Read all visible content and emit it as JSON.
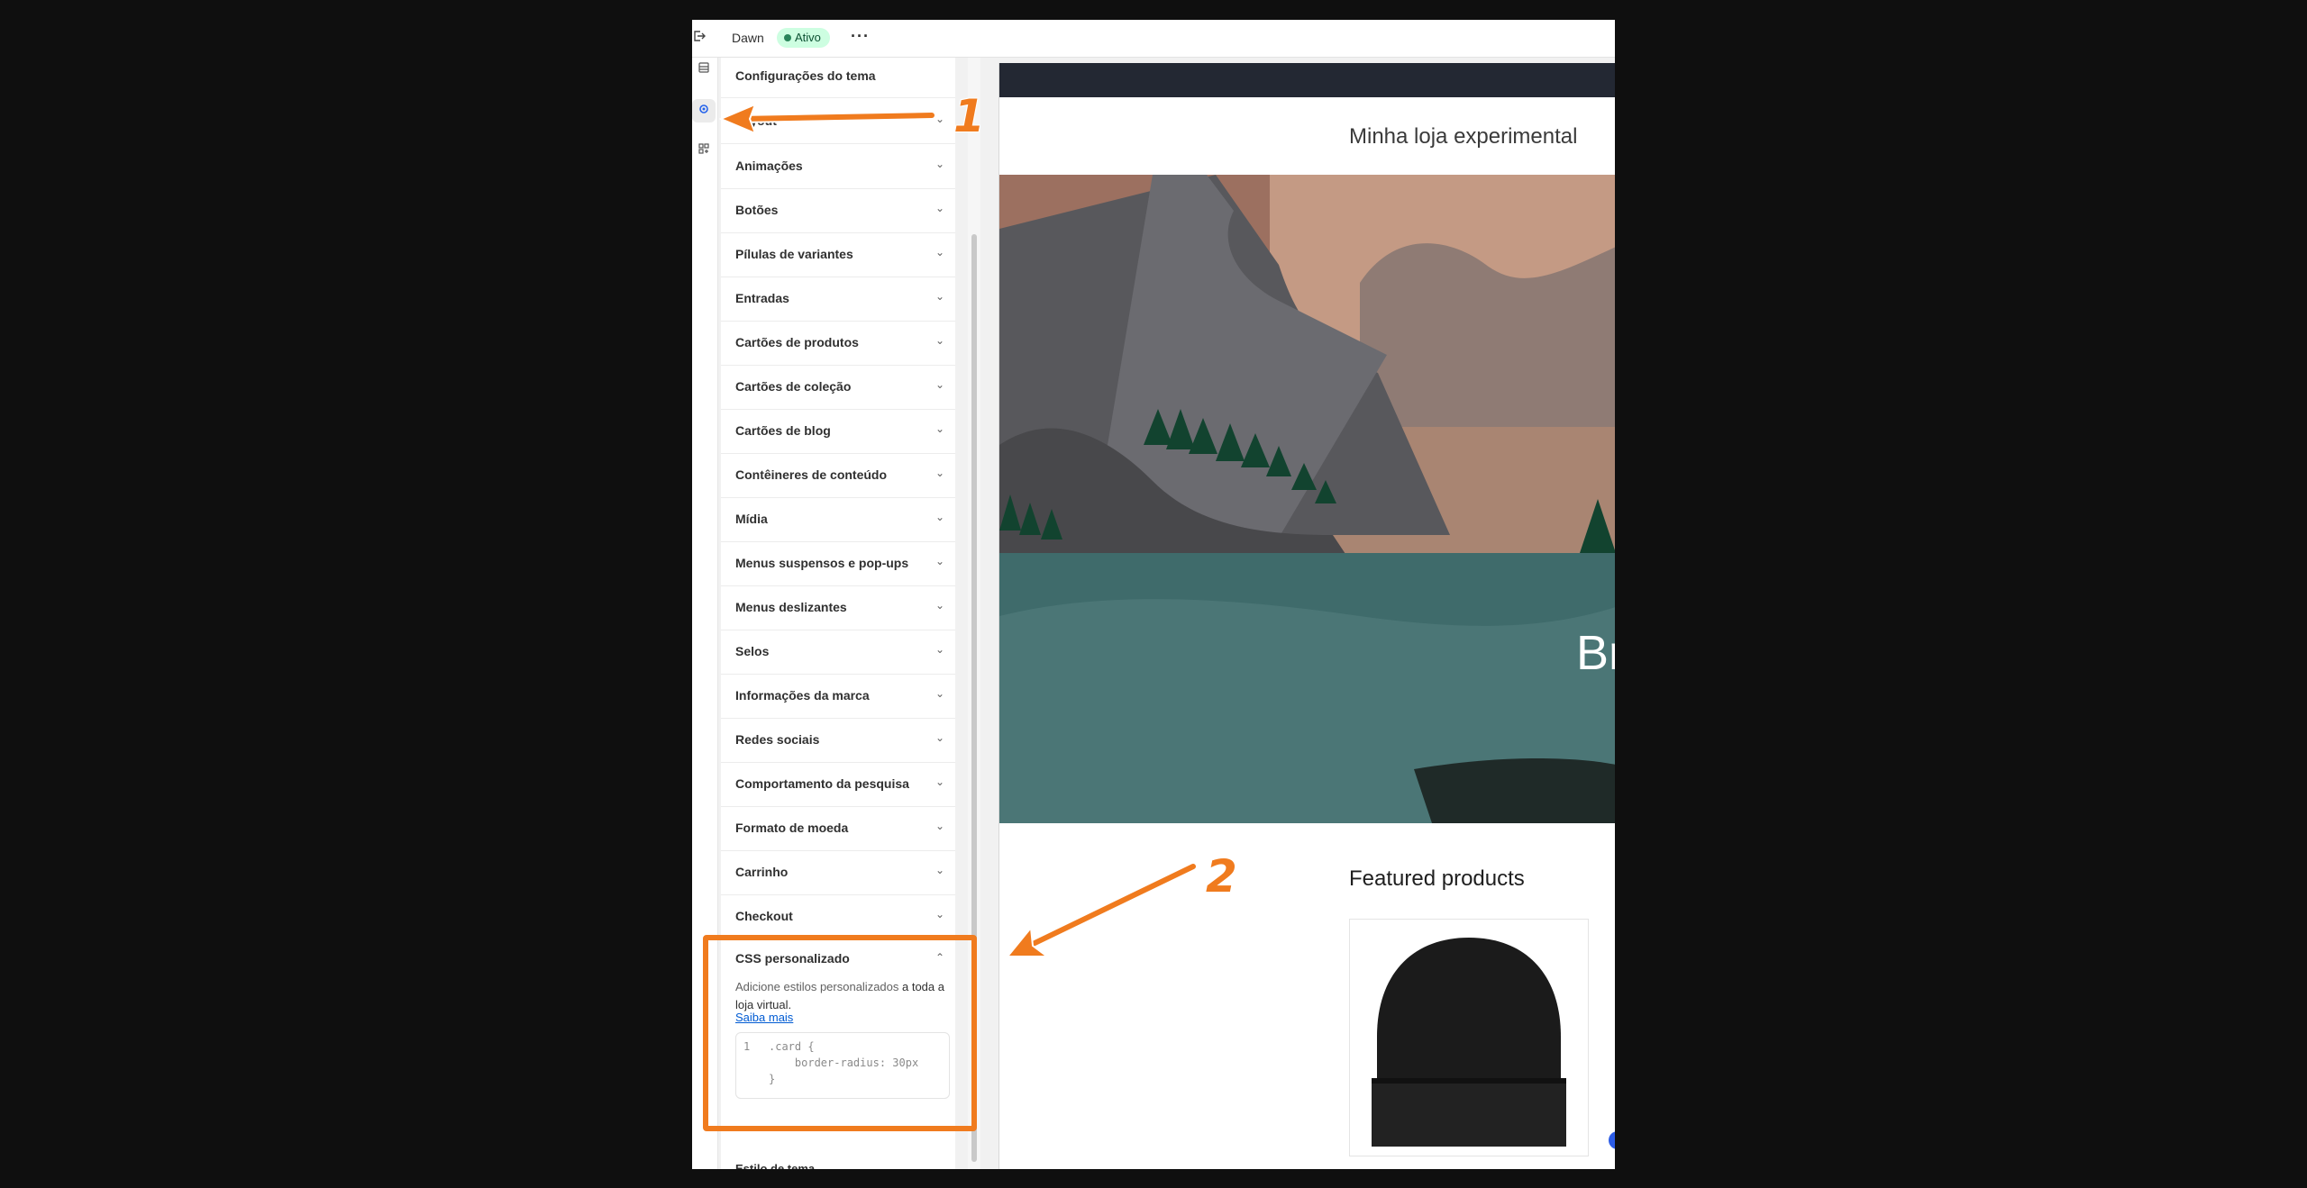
{
  "topbar": {
    "theme_name": "Dawn",
    "status_badge": "Ativo",
    "more_label": "···"
  },
  "rail": {
    "icons": [
      "sections-icon",
      "theme-settings-icon",
      "app-blocks-icon"
    ]
  },
  "panel": {
    "title": "Configurações do tema",
    "sections": [
      {
        "label": "Layout"
      },
      {
        "label": "Animações"
      },
      {
        "label": "Botões"
      },
      {
        "label": "Pílulas de variantes"
      },
      {
        "label": "Entradas"
      },
      {
        "label": "Cartões de produtos"
      },
      {
        "label": "Cartões de coleção"
      },
      {
        "label": "Cartões de blog"
      },
      {
        "label": "Contêineres de conteúdo"
      },
      {
        "label": "Mídia"
      },
      {
        "label": "Menus suspensos e pop-ups"
      },
      {
        "label": "Menus deslizantes"
      },
      {
        "label": "Selos"
      },
      {
        "label": "Informações da marca"
      },
      {
        "label": "Redes sociais"
      },
      {
        "label": "Comportamento da pesquisa"
      },
      {
        "label": "Formato de moeda"
      },
      {
        "label": "Carrinho"
      },
      {
        "label": "Checkout"
      }
    ],
    "custom_css": {
      "label": "CSS personalizado",
      "description_muted": "Adicione estilos personalizados",
      "description_rest": " a toda a loja virtual.",
      "learn_more": "Saiba mais",
      "line_number": "1",
      "code_line1": ".card {",
      "code_line2": "    border-radius: 30px",
      "code_line3": "}"
    },
    "next_section_partial": "Estilo de tema"
  },
  "preview": {
    "store_name": "Minha loja experimental",
    "hero_text": "Br",
    "featured_title": "Featured products"
  },
  "annotations": {
    "step1": "1",
    "step2": "2",
    "color": "#f07b1e"
  }
}
